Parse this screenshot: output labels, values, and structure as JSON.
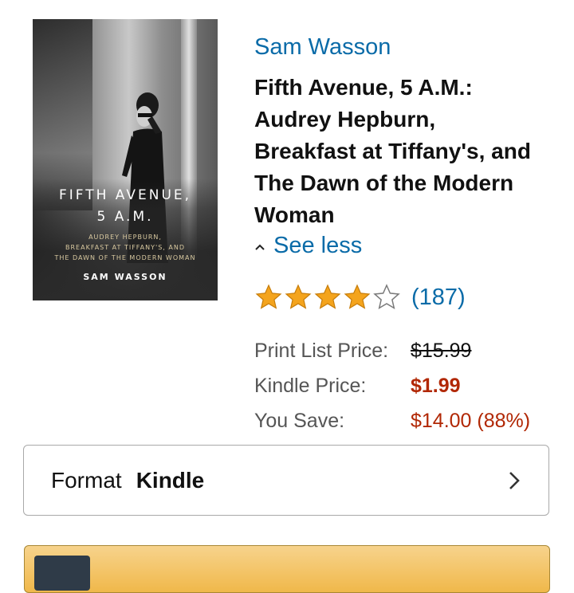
{
  "book": {
    "cover": {
      "title_line1": "FIFTH AVENUE,",
      "title_line2": "5 A.M.",
      "subtitle_line1": "AUDREY HEPBURN,",
      "subtitle_line2": "BREAKFAST AT TIFFANY'S, AND",
      "subtitle_line3": "THE DAWN OF THE MODERN WOMAN",
      "author": "SAM WASSON"
    },
    "author": "Sam Wasson",
    "title_lines": [
      "Fifth Avenue, 5 A.M.:",
      "Audrey Hepburn,",
      "Breakfast at Tiffany's, and",
      "The Dawn of the Modern",
      "Woman"
    ],
    "see_less": "See less"
  },
  "rating": {
    "stars": 4,
    "max_stars": 5,
    "count": "(187)"
  },
  "pricing": {
    "print_list_label": "Print List Price:",
    "print_list_value": "$15.99",
    "kindle_label": "Kindle Price:",
    "kindle_value": "$1.99",
    "save_label": "You Save:",
    "save_value": "$14.00 (88%)"
  },
  "format": {
    "label": "Format",
    "value": "Kindle"
  },
  "colors": {
    "link": "#0a6ba8",
    "price_red": "#b12704",
    "star_gold": "#f4a41d",
    "buy_button": "#f0b84a"
  }
}
